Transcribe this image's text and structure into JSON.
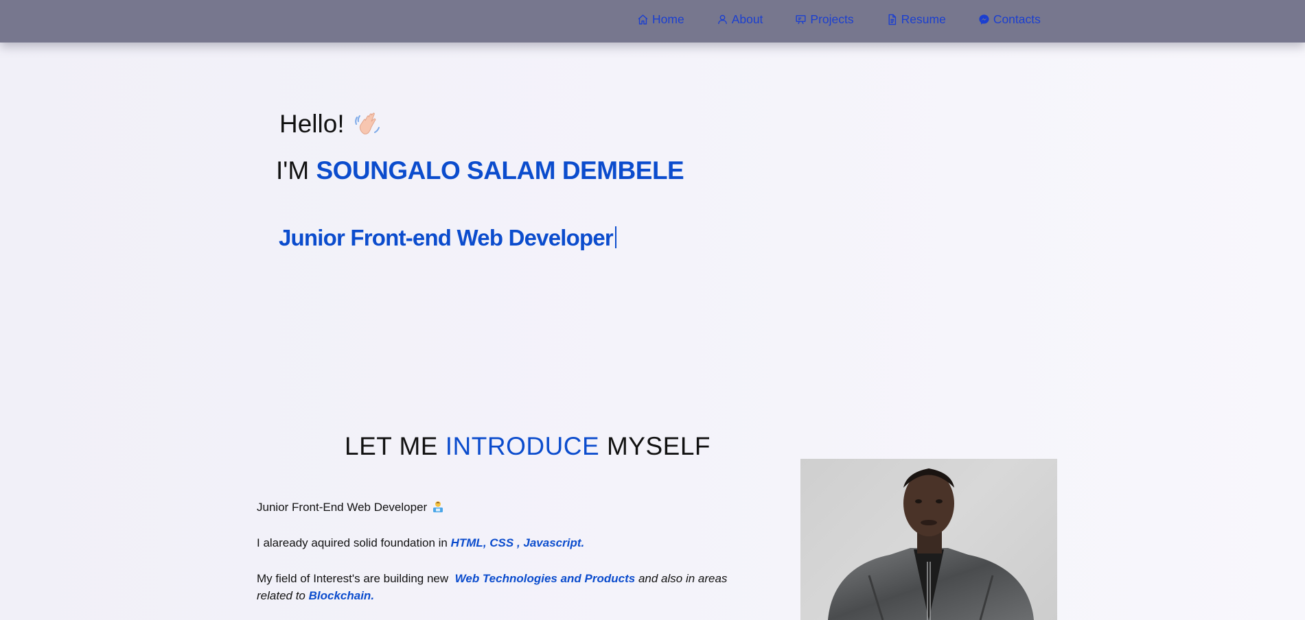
{
  "nav": {
    "items": [
      {
        "label": "Home",
        "icon": "home-icon"
      },
      {
        "label": "About",
        "icon": "user-icon"
      },
      {
        "label": "Projects",
        "icon": "projects-icon"
      },
      {
        "label": "Resume",
        "icon": "document-icon"
      },
      {
        "label": "Contacts",
        "icon": "messenger-icon"
      }
    ]
  },
  "hero": {
    "greeting": "Hello!",
    "greeting_icon": "waving-hand-icon",
    "im_prefix": "I'M",
    "name": "SOUNGALO SALAM DEMBELE",
    "role": "Junior Front-end Web Developer"
  },
  "intro": {
    "title_part1": "LET ME",
    "title_highlight": "INTRODUCE",
    "title_part2": "MYSELF",
    "p1_text": "Junior Front-End Web Developer",
    "p1_icon": "technologist-icon",
    "p2_text": "I alaready aquired solid foundation in",
    "p2_highlight": "HTML, CSS , Javascript.",
    "p3_text": "My field of Interest's are building new",
    "p3_highlight1": "Web Technologies and Products",
    "p3_middle": "and also in areas related to",
    "p3_highlight2": "Blockchain."
  },
  "colors": {
    "accent": "#0b4ccd",
    "navbar": "#77778e",
    "nav_link": "#1b3fd0"
  }
}
